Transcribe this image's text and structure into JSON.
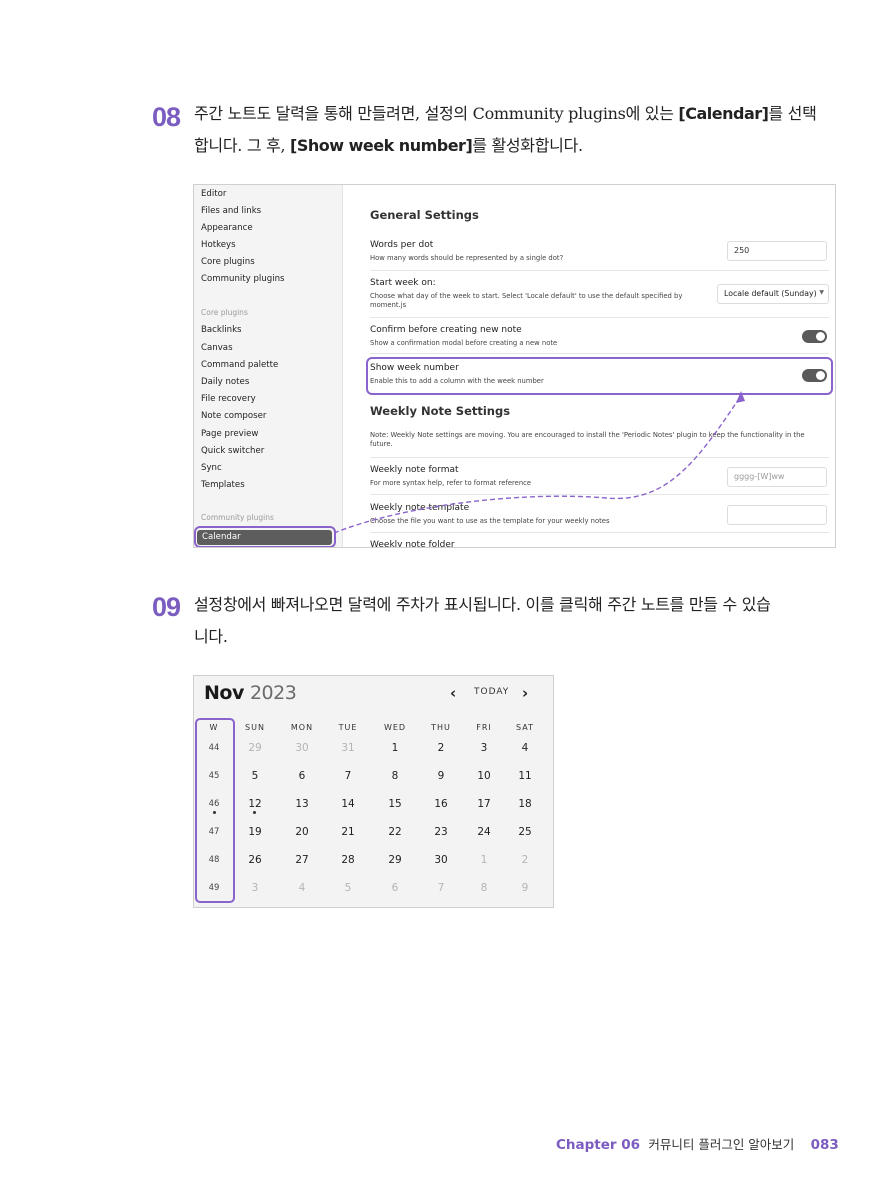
{
  "step08": {
    "number": "08",
    "line1_pre": "주간 노트도 달력을 통해 만들려면, 설정의 Community plugins에 있는 ",
    "line1_bold": "[Calendar]",
    "line1_post": "를 선택",
    "line2_pre": "합니다. 그 후, ",
    "line2_bold": "[Show week number]",
    "line2_post": "를 활성화합니다."
  },
  "settings": {
    "sidebar_top": [
      "Editor",
      "Files and links",
      "Appearance",
      "Hotkeys",
      "Core plugins",
      "Community plugins"
    ],
    "core_header": "Core plugins",
    "sidebar_core": [
      "Backlinks",
      "Canvas",
      "Command palette",
      "Daily notes",
      "File recovery",
      "Note composer",
      "Page preview",
      "Quick switcher",
      "Sync",
      "Templates"
    ],
    "community_header": "Community plugins",
    "selected": "Calendar",
    "general_heading": "General Settings",
    "words_per_dot": {
      "title": "Words per dot",
      "desc": "How many words should be represented by a single dot?",
      "value": "250"
    },
    "start_week": {
      "title": "Start week on:",
      "desc": "Choose what day of the week to start. Select 'Locale default' to use the default specified by moment.js",
      "value": "Locale default (Sunday)"
    },
    "confirm": {
      "title": "Confirm before creating new note",
      "desc": "Show a confirmation modal before creating a new note"
    },
    "show_week": {
      "title": "Show week number",
      "desc": "Enable this to add a column with the week number"
    },
    "weekly_heading": "Weekly Note Settings",
    "weekly_note": "Note: Weekly Note settings are moving. You are encouraged to install the 'Periodic Notes' plugin to keep the functionality in the future.",
    "weekly_format": {
      "title": "Weekly note format",
      "desc": "For more syntax help, refer to format reference",
      "placeholder": "gggg-[W]ww"
    },
    "weekly_template": {
      "title": "Weekly note template",
      "desc": "Choose the file you want to use as the template for your weekly notes"
    },
    "weekly_folder": {
      "title": "Weekly note folder"
    }
  },
  "step09": {
    "number": "09",
    "line1": "설정창에서 빠져나오면 달력에 주차가 표시됩니다. 이를 클릭해 주간 노트를 만들 수 있습",
    "line2": "니다."
  },
  "calendar": {
    "month": "Nov",
    "year": "2023",
    "prev_icon": "‹",
    "today": "TODAY",
    "next_icon": "›",
    "week_header": "W",
    "weekdays": [
      "SUN",
      "MON",
      "TUE",
      "WED",
      "THU",
      "FRI",
      "SAT"
    ],
    "rows": [
      {
        "week": "44",
        "days": [
          "29",
          "30",
          "31",
          "1",
          "2",
          "3",
          "4"
        ],
        "dim": [
          true,
          true,
          true,
          false,
          false,
          false,
          false
        ]
      },
      {
        "week": "45",
        "days": [
          "5",
          "6",
          "7",
          "8",
          "9",
          "10",
          "11"
        ],
        "dim": [
          false,
          false,
          false,
          false,
          false,
          false,
          false
        ]
      },
      {
        "week": "46",
        "days": [
          "12",
          "13",
          "14",
          "15",
          "16",
          "17",
          "18"
        ],
        "dim": [
          false,
          false,
          false,
          false,
          false,
          false,
          false
        ]
      },
      {
        "week": "47",
        "days": [
          "19",
          "20",
          "21",
          "22",
          "23",
          "24",
          "25"
        ],
        "dim": [
          false,
          false,
          false,
          false,
          false,
          false,
          false
        ]
      },
      {
        "week": "48",
        "days": [
          "26",
          "27",
          "28",
          "29",
          "30",
          "1",
          "2"
        ],
        "dim": [
          false,
          false,
          false,
          false,
          false,
          true,
          true
        ]
      },
      {
        "week": "49",
        "days": [
          "3",
          "4",
          "5",
          "6",
          "7",
          "8",
          "9"
        ],
        "dim": [
          true,
          true,
          true,
          true,
          true,
          true,
          true
        ]
      }
    ]
  },
  "footer": {
    "chapter": "Chapter 06",
    "title": "커뮤니티 플러그인 알아보기",
    "page": "083"
  },
  "colors": {
    "accent": "#7b5cc0",
    "highlight": "#8a63cc"
  }
}
